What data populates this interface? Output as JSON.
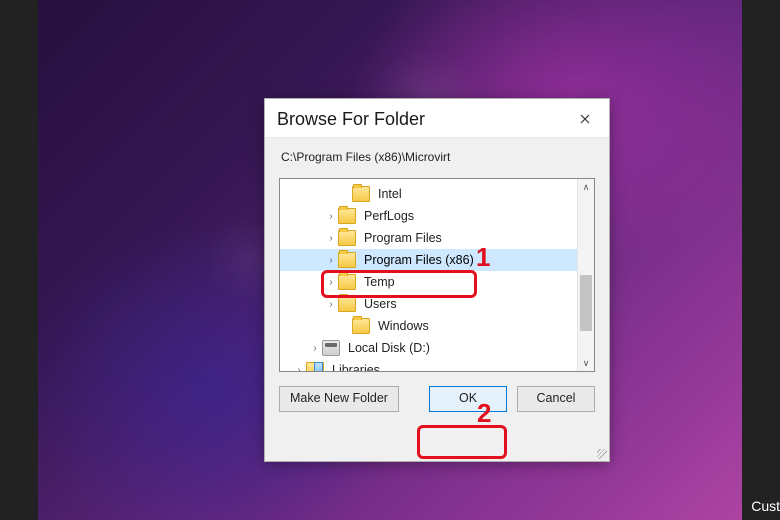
{
  "dialog": {
    "title": "Browse For Folder",
    "path": "C:\\Program Files (x86)\\Microvirt",
    "buttons": {
      "make_new_folder": "Make New Folder",
      "ok": "OK",
      "cancel": "Cancel"
    }
  },
  "tree": {
    "items": [
      {
        "indent": 58,
        "chevron": "none",
        "icon": "folder",
        "label": "Intel",
        "selected": false
      },
      {
        "indent": 44,
        "chevron": "right",
        "icon": "folder",
        "label": "PerfLogs",
        "selected": false
      },
      {
        "indent": 44,
        "chevron": "right",
        "icon": "folder",
        "label": "Program Files",
        "selected": false
      },
      {
        "indent": 44,
        "chevron": "right",
        "icon": "folder",
        "label": "Program Files (x86)",
        "selected": true
      },
      {
        "indent": 44,
        "chevron": "right",
        "icon": "folder",
        "label": "Temp",
        "selected": false
      },
      {
        "indent": 44,
        "chevron": "right",
        "icon": "folder",
        "label": "Users",
        "selected": false
      },
      {
        "indent": 58,
        "chevron": "none",
        "icon": "folder",
        "label": "Windows",
        "selected": false
      },
      {
        "indent": 28,
        "chevron": "right",
        "icon": "disk",
        "label": "Local Disk (D:)",
        "selected": false
      },
      {
        "indent": 12,
        "chevron": "right",
        "icon": "lib",
        "label": "Libraries",
        "selected": false
      }
    ]
  },
  "annotations": {
    "n1": "1",
    "n2": "2"
  },
  "misc": {
    "corner": "Cust"
  }
}
